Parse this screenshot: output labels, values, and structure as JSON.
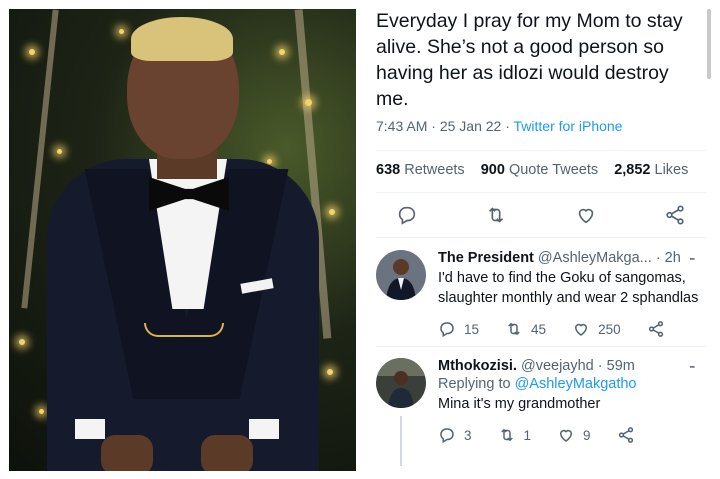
{
  "tweet": {
    "text": "Everyday I pray for my Mom to stay alive. She’s not a good person so having her as idlozi would destroy me.",
    "time": "7:43 AM",
    "date": "25 Jan 22",
    "source": "Twitter for iPhone",
    "sep": "·",
    "retweets_count": "638",
    "retweets_label": "Retweets",
    "quotes_count": "900",
    "quotes_label": "Quote Tweets",
    "likes_count": "2,852",
    "likes_label": "Likes"
  },
  "replies": [
    {
      "name": "The President",
      "handle": "@AshleyMakga...",
      "time": "· 2h",
      "text": "I'd have to find the Goku of sangomas, slaughter monthly and wear 2 sphandlas",
      "reply_count": "15",
      "retweet_count": "45",
      "like_count": "250"
    },
    {
      "name": "Mthokozisi.",
      "handle": "@veejayhd",
      "time": "· 59m",
      "replying_label": "Replying to",
      "replying_to": "@AshleyMakgatho",
      "text": "Mina it's my grandmother",
      "reply_count": "3",
      "retweet_count": "1",
      "like_count": "9"
    }
  ],
  "icons": {
    "reply": "reply-icon",
    "retweet": "retweet-icon",
    "like": "heart-icon",
    "share": "share-icon",
    "more": "more-icon"
  },
  "colors": {
    "link": "#1d9bf0",
    "muted": "#536471",
    "text": "#0f1419"
  }
}
